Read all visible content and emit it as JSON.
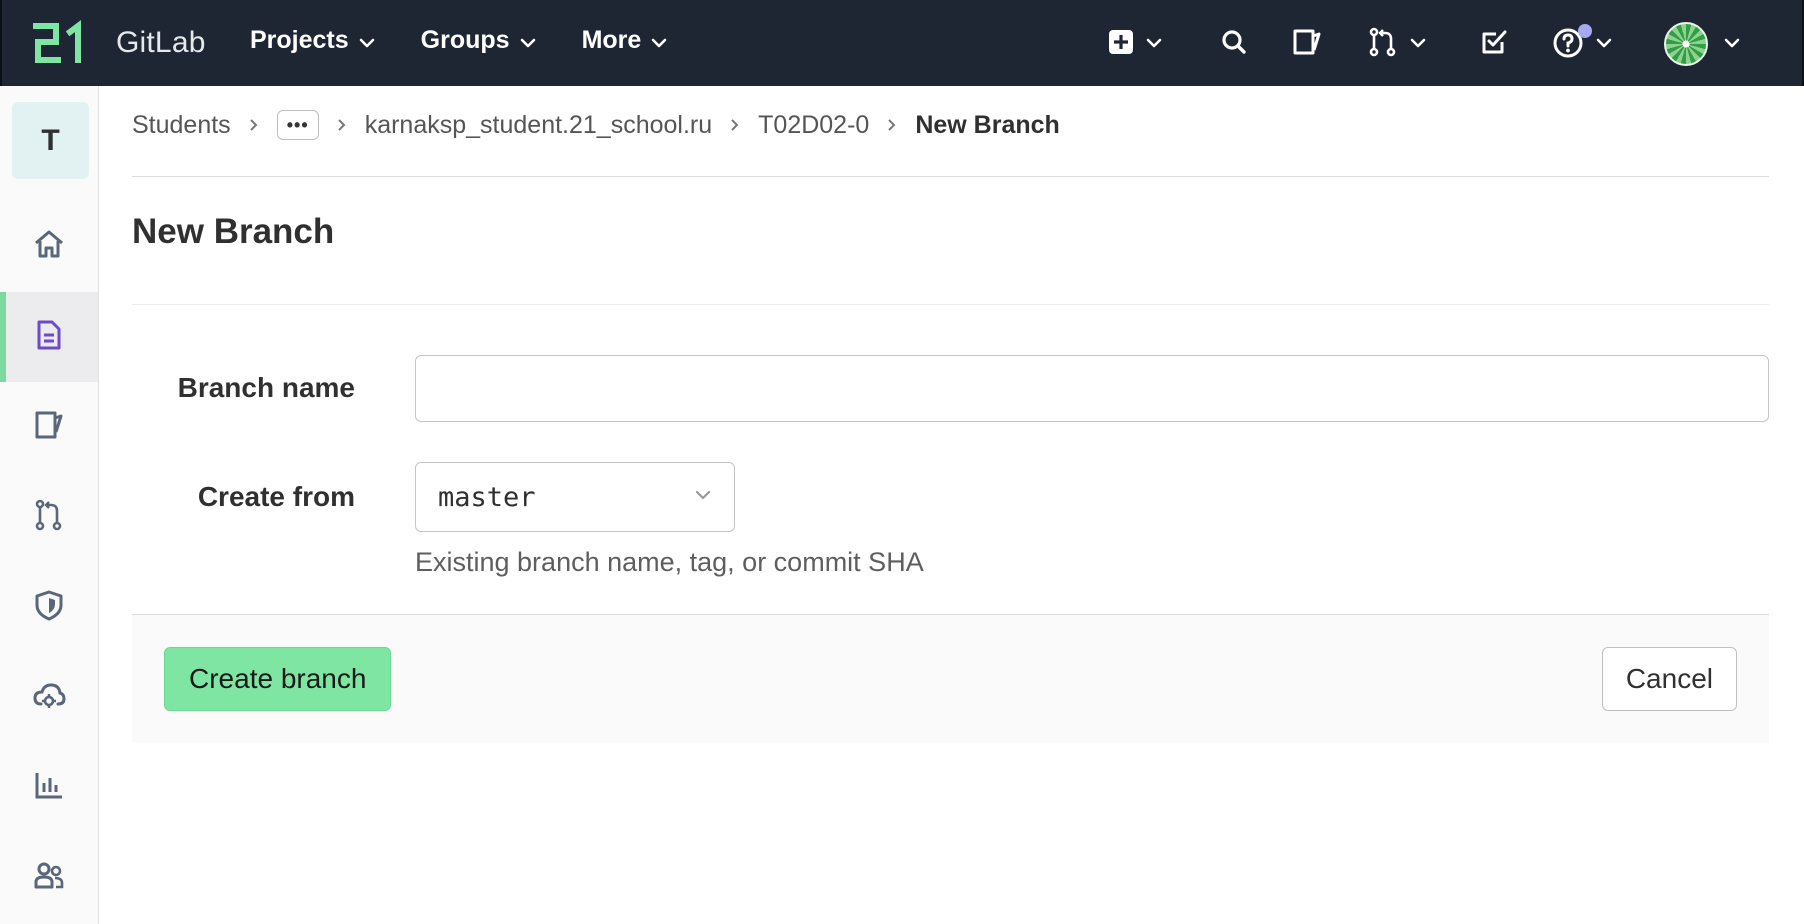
{
  "app": {
    "name": "GitLab",
    "logo_icon": "school-21-logo-icon",
    "accent_color": "#7ee5a2",
    "navbar_color": "#1f2633"
  },
  "navbar": {
    "menus": [
      {
        "label": "Projects"
      },
      {
        "label": "Groups"
      },
      {
        "label": "More"
      }
    ],
    "icons": [
      "plus-square-icon",
      "search-icon",
      "issues-icon",
      "merge-request-icon",
      "todo-icon",
      "help-icon",
      "avatar"
    ]
  },
  "sidebar": {
    "project_initial": "T",
    "items": [
      {
        "icon": "home-icon"
      },
      {
        "icon": "repository-icon",
        "active": true
      },
      {
        "icon": "issues-icon"
      },
      {
        "icon": "merge-request-icon"
      },
      {
        "icon": "shield-icon"
      },
      {
        "icon": "deployments-icon"
      },
      {
        "icon": "analytics-icon"
      },
      {
        "icon": "members-icon"
      }
    ]
  },
  "breadcrumb": {
    "items": [
      "Students",
      "karnaksp_student.21_school.ru",
      "T02D02-0"
    ],
    "ellipsis": "•••",
    "current": "New Branch"
  },
  "page": {
    "title": "New Branch"
  },
  "form": {
    "branch_name_label": "Branch name",
    "branch_name_value": "",
    "create_from_label": "Create from",
    "create_from_value": "master",
    "help_text": "Existing branch name, tag, or commit SHA",
    "create_button": "Create branch",
    "cancel_button": "Cancel"
  }
}
